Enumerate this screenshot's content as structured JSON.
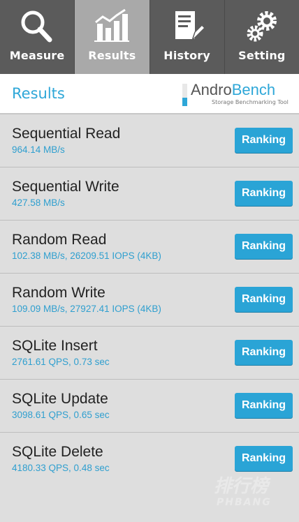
{
  "tabs": [
    {
      "label": "Measure",
      "icon": "magnifier-icon",
      "active": false
    },
    {
      "label": "Results",
      "icon": "bar-chart-icon",
      "active": true
    },
    {
      "label": "History",
      "icon": "document-pencil-icon",
      "active": false
    },
    {
      "label": "Setting",
      "icon": "gears-icon",
      "active": false
    }
  ],
  "header": {
    "title": "Results",
    "logo_name_a": "Andro",
    "logo_name_b": "Bench",
    "logo_subtitle": "Storage Benchmarking Tool"
  },
  "results": [
    {
      "name": "Sequential Read",
      "value": "964.14 MB/s",
      "button": "Ranking"
    },
    {
      "name": "Sequential Write",
      "value": "427.58 MB/s",
      "button": "Ranking"
    },
    {
      "name": "Random Read",
      "value": "102.38 MB/s, 26209.51 IOPS (4KB)",
      "button": "Ranking"
    },
    {
      "name": "Random Write",
      "value": "109.09 MB/s, 27927.41 IOPS (4KB)",
      "button": "Ranking"
    },
    {
      "name": "SQLite Insert",
      "value": "2761.61 QPS, 0.73 sec",
      "button": "Ranking"
    },
    {
      "name": "SQLite Update",
      "value": "3098.61 QPS, 0.65 sec",
      "button": "Ranking"
    },
    {
      "name": "SQLite Delete",
      "value": "4180.33 QPS, 0.48 sec",
      "button": "Ranking"
    }
  ],
  "watermark": {
    "line1": "排行榜",
    "line2": "PHBANG"
  },
  "colors": {
    "accent": "#2ea7d8",
    "tabbar": "#5b5b5b",
    "tab_active": "#a9a9a9",
    "background": "#dedede"
  }
}
